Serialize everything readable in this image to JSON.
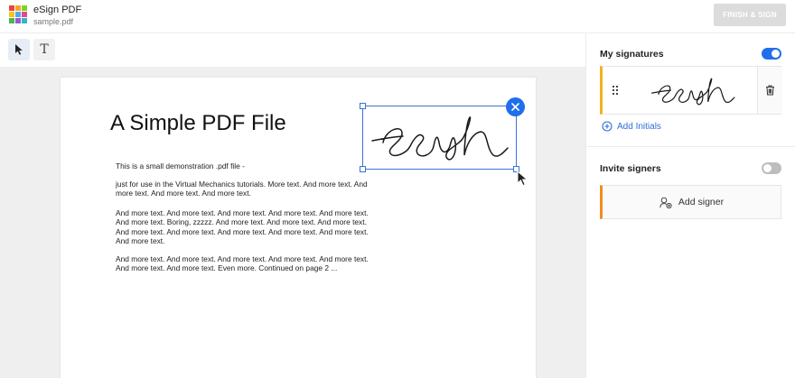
{
  "header": {
    "app_title": "eSign PDF",
    "file_name": "sample.pdf",
    "finish_label": "FINISH & SIGN"
  },
  "toolbar": {
    "tools": [
      "select-tool",
      "text-tool"
    ],
    "text_tool_glyph": "T"
  },
  "document": {
    "title": "A Simple PDF File",
    "paragraphs": [
      "This is a small demonstration .pdf file -",
      "just for use in the Virtual Mechanics tutorials. More text. And more text. And more text. And more text. And more text.",
      "And more text. And more text. And more text. And more text. And more text. And more text. Boring, zzzzz. And more text. And more text. And more text. And more text. And more text. And more text. And more text. And more text. And more text.",
      "And more text. And more text. And more text. And more text. And more text. And more text. And more text. Even more. Continued on page 2 ..."
    ]
  },
  "sidebar": {
    "my_signatures": {
      "title": "My signatures",
      "toggle_on": true,
      "add_initials_label": "Add Initials"
    },
    "invite_signers": {
      "title": "Invite signers",
      "toggle_on": false,
      "add_signer_label": "Add signer"
    }
  },
  "colors": {
    "accent": "#1f6feb",
    "signature_card_border": "#f2b01e",
    "signer_card_border": "#f28c1e",
    "finish_button_disabled": "#dcdcdc"
  },
  "icons": [
    "app-logo-icon",
    "cursor-arrow-icon",
    "text-icon",
    "close-icon",
    "drag-handle-icon",
    "trash-icon",
    "plus-circle-icon",
    "add-user-icon",
    "mouse-pointer-icon"
  ]
}
